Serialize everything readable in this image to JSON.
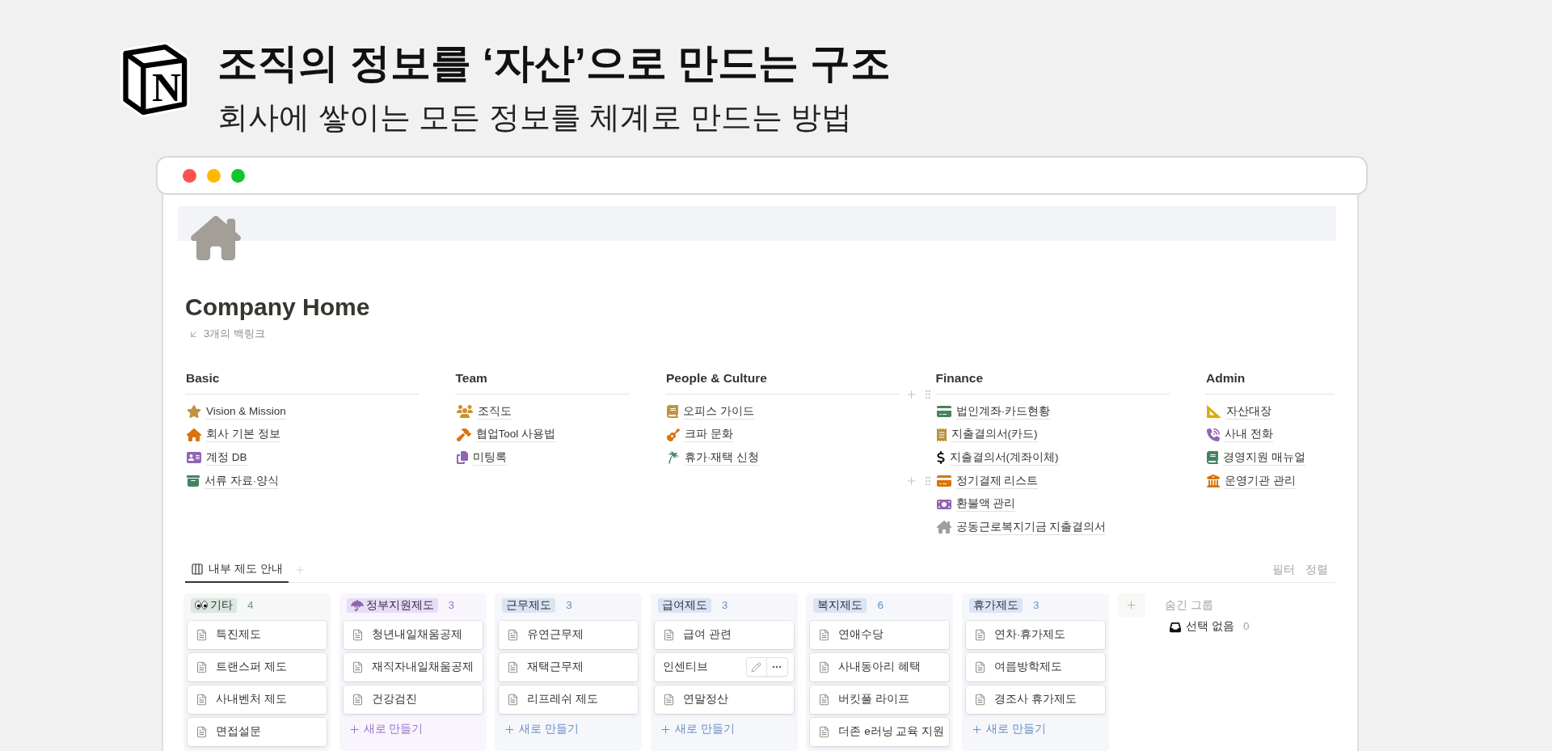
{
  "header": {
    "logo_letter": "N",
    "title": "조직의 정보를 ‘자산’으로 만드는 구조",
    "subtitle": "회사에 쌓이는 모든 정보를 체계로 만드는 방법"
  },
  "page": {
    "title": "Company Home",
    "backlinks": "3개의 백링크"
  },
  "sections": [
    {
      "title": "Basic",
      "divider_hovered": false,
      "links": [
        {
          "label": "Vision & Mission",
          "hovered": false
        },
        {
          "label": "회사 기본 정보",
          "hovered": false
        },
        {
          "label": "계정 DB",
          "hovered": false
        },
        {
          "label": "서류 자료·양식",
          "hovered": false
        }
      ]
    },
    {
      "title": "Team",
      "divider_hovered": false,
      "links": [
        {
          "label": "조직도",
          "hovered": false
        },
        {
          "label": "협업Tool 사용법",
          "hovered": false
        },
        {
          "label": "미팅록",
          "hovered": false
        }
      ]
    },
    {
      "title": "People & Culture",
      "divider_hovered": false,
      "links": [
        {
          "label": "오피스 가이드",
          "hovered": false
        },
        {
          "label": "크파 문화",
          "hovered": false
        },
        {
          "label": "휴가·재택 신청",
          "hovered": false
        }
      ]
    },
    {
      "title": "Finance",
      "divider_hovered": true,
      "links": [
        {
          "label": "법인계좌·카드현황",
          "hovered": false
        },
        {
          "label": "지출결의서(카드)",
          "hovered": false
        },
        {
          "label": "지출결의서(계좌이체)",
          "hovered": false
        },
        {
          "label": "정기결제 리스트",
          "hovered": true
        },
        {
          "label": "환불액 관리",
          "hovered": false
        },
        {
          "label": "공동근로복지기금 지출결의서",
          "hovered": false
        }
      ]
    },
    {
      "title": "Admin",
      "divider_hovered": false,
      "links": [
        {
          "label": "자산대장",
          "hovered": false
        },
        {
          "label": "사내 전화",
          "hovered": false
        },
        {
          "label": "경영지원 매뉴얼",
          "hovered": false
        },
        {
          "label": "운영기관 관리",
          "hovered": false
        }
      ]
    }
  ],
  "board": {
    "tabs": [
      {
        "label": "내부 제도 안내",
        "selected": true
      }
    ],
    "actions": [
      "필터",
      "정렬"
    ],
    "columns": [
      {
        "label": "기타",
        "count": "4",
        "color": "#6c9b7d",
        "cards": [
          {
            "title": "특진제도",
            "doc_icon": true,
            "hovered": false
          },
          {
            "title": "트랜스퍼 제도",
            "doc_icon": true,
            "hovered": false
          },
          {
            "title": "사내벤처 제도",
            "doc_icon": true,
            "hovered": false
          },
          {
            "title": "면접설문",
            "doc_icon": true,
            "hovered": false
          }
        ]
      },
      {
        "label": "정부지원제도",
        "count": "3",
        "color": "#9a73d2",
        "new_button": "새로 만들기",
        "cards": [
          {
            "title": "청년내일채움공제",
            "doc_icon": true,
            "hovered": false
          },
          {
            "title": "재직자내일채움공제",
            "doc_icon": true,
            "hovered": false
          },
          {
            "title": "건강검진",
            "doc_icon": true,
            "hovered": false
          }
        ]
      },
      {
        "label": "근무제도",
        "count": "3",
        "color": "#6a8fc6",
        "new_button": "새로 만들기",
        "cards": [
          {
            "title": "유연근무제",
            "doc_icon": true,
            "hovered": false
          },
          {
            "title": "재택근무제",
            "doc_icon": true,
            "hovered": false
          },
          {
            "title": "리프레쉬 제도",
            "doc_icon": true,
            "hovered": false
          }
        ]
      },
      {
        "label": "급여제도",
        "count": "3",
        "color": "#6a8fc6",
        "new_button": "새로 만들기",
        "cards": [
          {
            "title": "급여 관련",
            "doc_icon": true,
            "hovered": false
          },
          {
            "title": "인센티브",
            "doc_icon": false,
            "hovered": true
          },
          {
            "title": "연말정산",
            "doc_icon": true,
            "hovered": false
          }
        ]
      },
      {
        "label": "복지제도",
        "count": "6",
        "color": "#6a8fc6",
        "cards": [
          {
            "title": "연애수당",
            "doc_icon": true,
            "hovered": false
          },
          {
            "title": "사내동아리 혜택",
            "doc_icon": true,
            "hovered": false
          },
          {
            "title": "버킷풀 라이프",
            "doc_icon": true,
            "hovered": false
          },
          {
            "title": "더존 e러닝 교육 지원",
            "doc_icon": true,
            "hovered": false
          }
        ]
      },
      {
        "label": "휴가제도",
        "count": "3",
        "color": "#6a8fc6",
        "new_button": "새로 만들기",
        "cards": [
          {
            "title": "연차·휴가제도",
            "doc_icon": true,
            "hovered": false
          },
          {
            "title": "여름방학제도",
            "doc_icon": true,
            "hovered": false
          },
          {
            "title": "경조사 휴가제도",
            "doc_icon": true,
            "hovered": false
          }
        ]
      }
    ],
    "hidden": {
      "title": "숨긴 그룹",
      "groups": [
        {
          "label": "선택 없음",
          "count": "0"
        }
      ]
    }
  }
}
